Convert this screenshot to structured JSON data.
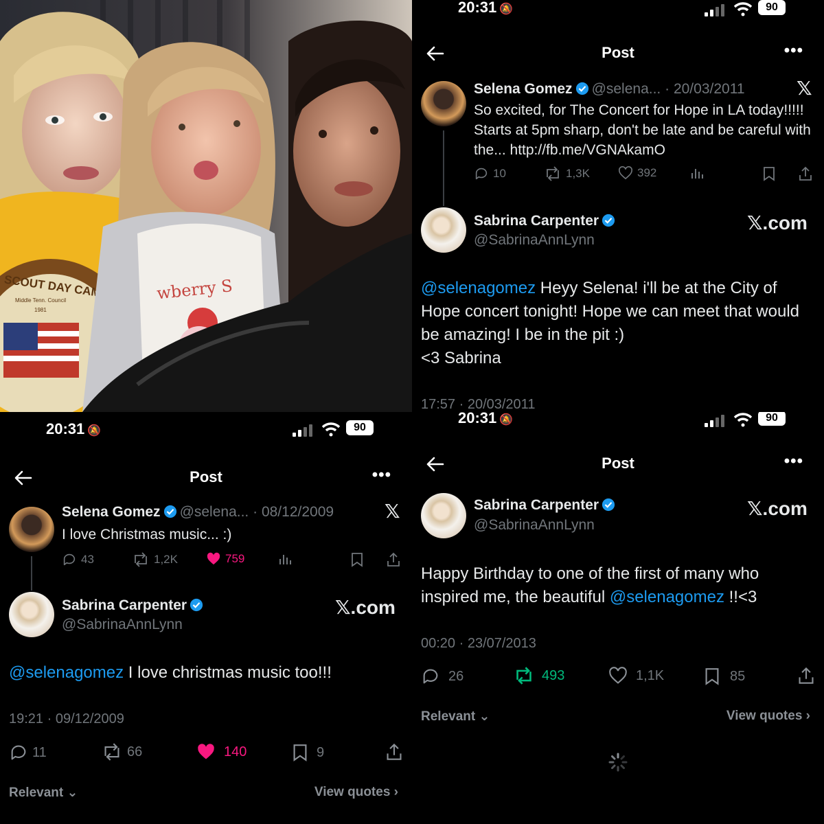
{
  "photo": {
    "tshirt_left": "SCOUT DAY CAMP",
    "tshirt_left_sub": "Middle Tenn. Council",
    "tshirt_left_year": "1981",
    "tshirt_mid": "wberry S"
  },
  "status": {
    "time": "20:31",
    "battery": "90"
  },
  "nav": {
    "title": "Post"
  },
  "tr": {
    "quoted": {
      "name": "Selena Gomez",
      "handle": "@selena...",
      "date": "· 20/03/2011",
      "text": "So excited, for The Concert for Hope in LA today!!!!! Starts at 5pm sharp, don't be late and be careful with the... http://fb.me/VGNAkamO",
      "replies": "10",
      "reposts": "1,3K",
      "likes": "392"
    },
    "reply": {
      "name": "Sabrina Carpenter",
      "handle": "@SabrinaAnnLynn",
      "source": "𝕏.com",
      "mention": "@selenagomez",
      "text": " Heyy Selena! i'll be at the City of Hope concert tonight! Hope we can meet that would be amazing! I be in the pit :)",
      "signoff": "<3 Sabrina",
      "timestamp": "17:57 · 20/03/2011"
    }
  },
  "bl": {
    "quoted": {
      "name": "Selena Gomez",
      "handle": "@selena...",
      "date": "· 08/12/2009",
      "text": "I love Christmas music... :)",
      "replies": "43",
      "reposts": "1,2K",
      "likes": "759"
    },
    "reply": {
      "name": "Sabrina Carpenter",
      "handle": "@SabrinaAnnLynn",
      "source": "𝕏.com",
      "mention": "@selenagomez",
      "text": " I love christmas music too!!!",
      "timestamp": "19:21 · 09/12/2009",
      "replies": "11",
      "reposts": "66",
      "likes": "140",
      "bookmarks": "9"
    },
    "relevant": "Relevant",
    "view_quotes": "View quotes"
  },
  "br": {
    "reply": {
      "name": "Sabrina Carpenter",
      "handle": "@SabrinaAnnLynn",
      "source": "𝕏.com",
      "text_before": "Happy Birthday to one of the first of many who inspired me, the beautiful ",
      "mention": "@selenagomez",
      "text_after": " !!<3",
      "timestamp": "00:20 · 23/07/2013",
      "replies": "26",
      "reposts": "493",
      "likes": "1,1K",
      "bookmarks": "85"
    },
    "relevant": "Relevant",
    "view_quotes": "View quotes"
  },
  "colors": {
    "link": "#1d9bf0",
    "like": "#f91880",
    "repost": "#00ba7c",
    "muted": "#71767b"
  }
}
